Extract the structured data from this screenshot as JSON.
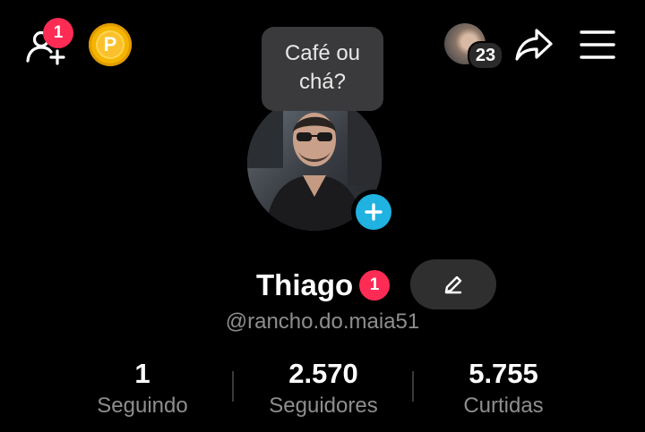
{
  "top_bar": {
    "friend_requests_badge": "1",
    "coin_label": "P",
    "visitors_count": "23"
  },
  "bubble": {
    "line1": "Café ou",
    "line2": "chá?"
  },
  "profile": {
    "name": "Thiago",
    "name_badge": "1",
    "handle": "@rancho.do.maia51"
  },
  "stats": {
    "following": {
      "value": "1",
      "label": "Seguindo"
    },
    "followers": {
      "value": "2.570",
      "label": "Seguidores"
    },
    "likes": {
      "value": "5.755",
      "label": "Curtidas"
    }
  },
  "colors": {
    "accent_red": "#fe2c55",
    "accent_blue": "#20b2e0",
    "coin_gold": "#f4b400"
  },
  "icons": [
    "add-friends-icon",
    "coin-icon",
    "share-icon",
    "menu-icon",
    "plus-icon",
    "pencil-icon"
  ]
}
